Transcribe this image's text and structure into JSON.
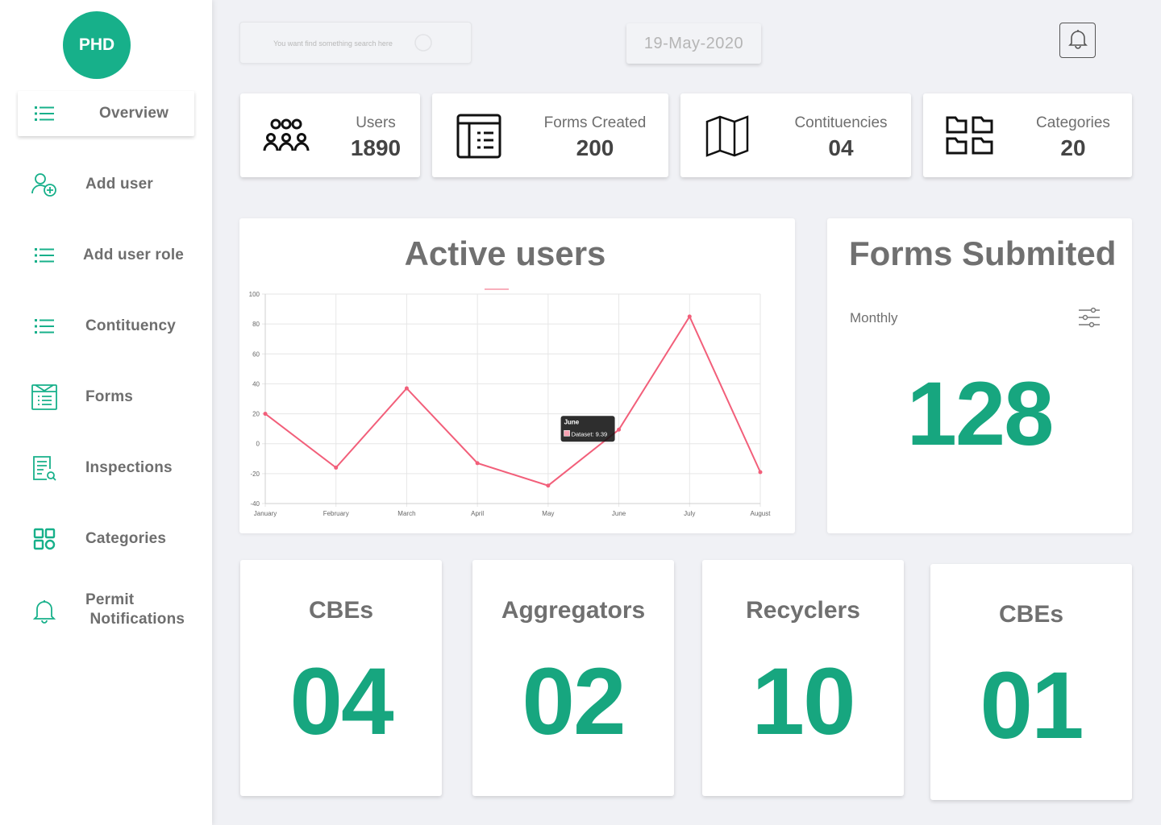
{
  "brand": {
    "logo_text": "PHD",
    "accent": "#17b08a"
  },
  "sidebar": {
    "items": [
      {
        "label": "Overview",
        "icon": "list-icon",
        "active": true
      },
      {
        "label": "Add user",
        "icon": "add-user-icon"
      },
      {
        "label": "Add user role",
        "icon": "list-icon"
      },
      {
        "label": "Contituency",
        "icon": "list-icon"
      },
      {
        "label": "Forms",
        "icon": "form-icon"
      },
      {
        "label": "Inspections",
        "icon": "inspection-icon"
      },
      {
        "label": "Categories",
        "icon": "categories-icon"
      },
      {
        "label_line1": "Permit",
        "label_line2": "Notifications",
        "icon": "bell-icon"
      }
    ]
  },
  "header": {
    "search_placeholder": "You want find something search here",
    "date": "19-May-2020",
    "notification_icon": "bell-icon"
  },
  "stats": [
    {
      "label": "Users",
      "value": "1890",
      "icon": "users-group-icon"
    },
    {
      "label": "Forms Created",
      "value": "200",
      "icon": "table-icon"
    },
    {
      "label": "Contituencies",
      "value": "04",
      "icon": "map-icon"
    },
    {
      "label": "Categories",
      "value": "20",
      "icon": "categories-icon"
    }
  ],
  "active_users": {
    "title": "Active users",
    "tooltip": {
      "title": "June",
      "label": "Dataset: 9.39"
    }
  },
  "chart_data": {
    "type": "line",
    "title": "Active users",
    "categories": [
      "January",
      "February",
      "March",
      "April",
      "May",
      "June",
      "July",
      "August"
    ],
    "series": [
      {
        "values": [
          20,
          -16,
          37,
          -13,
          -28,
          9.39,
          85,
          -19
        ],
        "color": "#f25f7a"
      }
    ],
    "ylim": [
      -40,
      100
    ],
    "yticks": [
      100,
      80,
      60,
      40,
      20,
      0,
      -20,
      -40
    ],
    "grid": true
  },
  "forms_submitted": {
    "title": "Forms Submited",
    "period": "Monthly",
    "value": "128"
  },
  "summary_cards": [
    {
      "title": "CBEs",
      "value": "04"
    },
    {
      "title": "Aggregators",
      "value": "02"
    },
    {
      "title": "Recyclers",
      "value": "10"
    },
    {
      "title": "CBEs",
      "value": "01"
    }
  ]
}
